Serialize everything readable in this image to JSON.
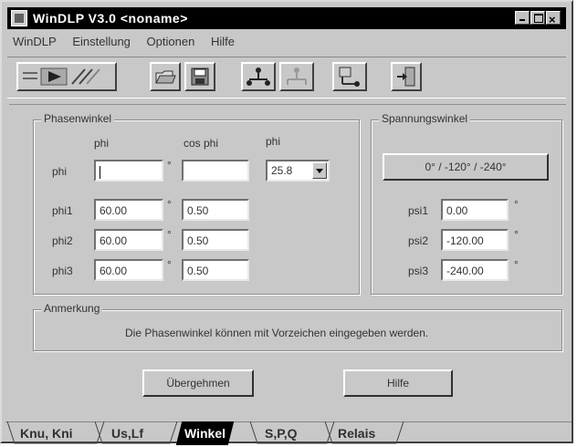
{
  "window": {
    "title": "WinDLP V3.0  <noname>"
  },
  "menu": [
    "WinDLP",
    "Einstellung",
    "Optionen",
    "Hilfe"
  ],
  "phase": {
    "group_label": "Phasenwinkel",
    "col_phi": "phi",
    "col_cosphi": "cos phi",
    "col_phi2": "phi",
    "rows": [
      {
        "label": "phi",
        "phi_value": "",
        "deg": "°",
        "cos_value": ""
      },
      {
        "label": "phi1",
        "phi_value": "60.00",
        "deg": "°",
        "cos_value": "0.50"
      },
      {
        "label": "phi2",
        "phi_value": "60.00",
        "deg": "°",
        "cos_value": "0.50"
      },
      {
        "label": "phi3",
        "phi_value": "60.00",
        "deg": "°",
        "cos_value": "0.50"
      }
    ],
    "select_value": "25.8"
  },
  "voltage": {
    "group_label": "Spannungswinkel",
    "preset_button": "0° / -120° / -240°",
    "rows": [
      {
        "label": "psi1",
        "value": "0.00",
        "deg": "°"
      },
      {
        "label": "psi2",
        "value": "-120.00",
        "deg": "°"
      },
      {
        "label": "psi3",
        "value": "-240.00",
        "deg": "°"
      }
    ]
  },
  "note": {
    "group_label": "Anmerkung",
    "text": "Die Phasenwinkel können mit Vorzeichen eingegeben werden."
  },
  "buttons": {
    "apply": "Übergehmen",
    "help": "Hilfe"
  },
  "tabs": [
    {
      "label": "Knu, Kni",
      "active": false
    },
    {
      "label": "Us,Lf",
      "active": false
    },
    {
      "label": "Winkel",
      "active": true
    },
    {
      "label": "S,P,Q",
      "active": false
    },
    {
      "label": "Relais",
      "active": false
    }
  ]
}
